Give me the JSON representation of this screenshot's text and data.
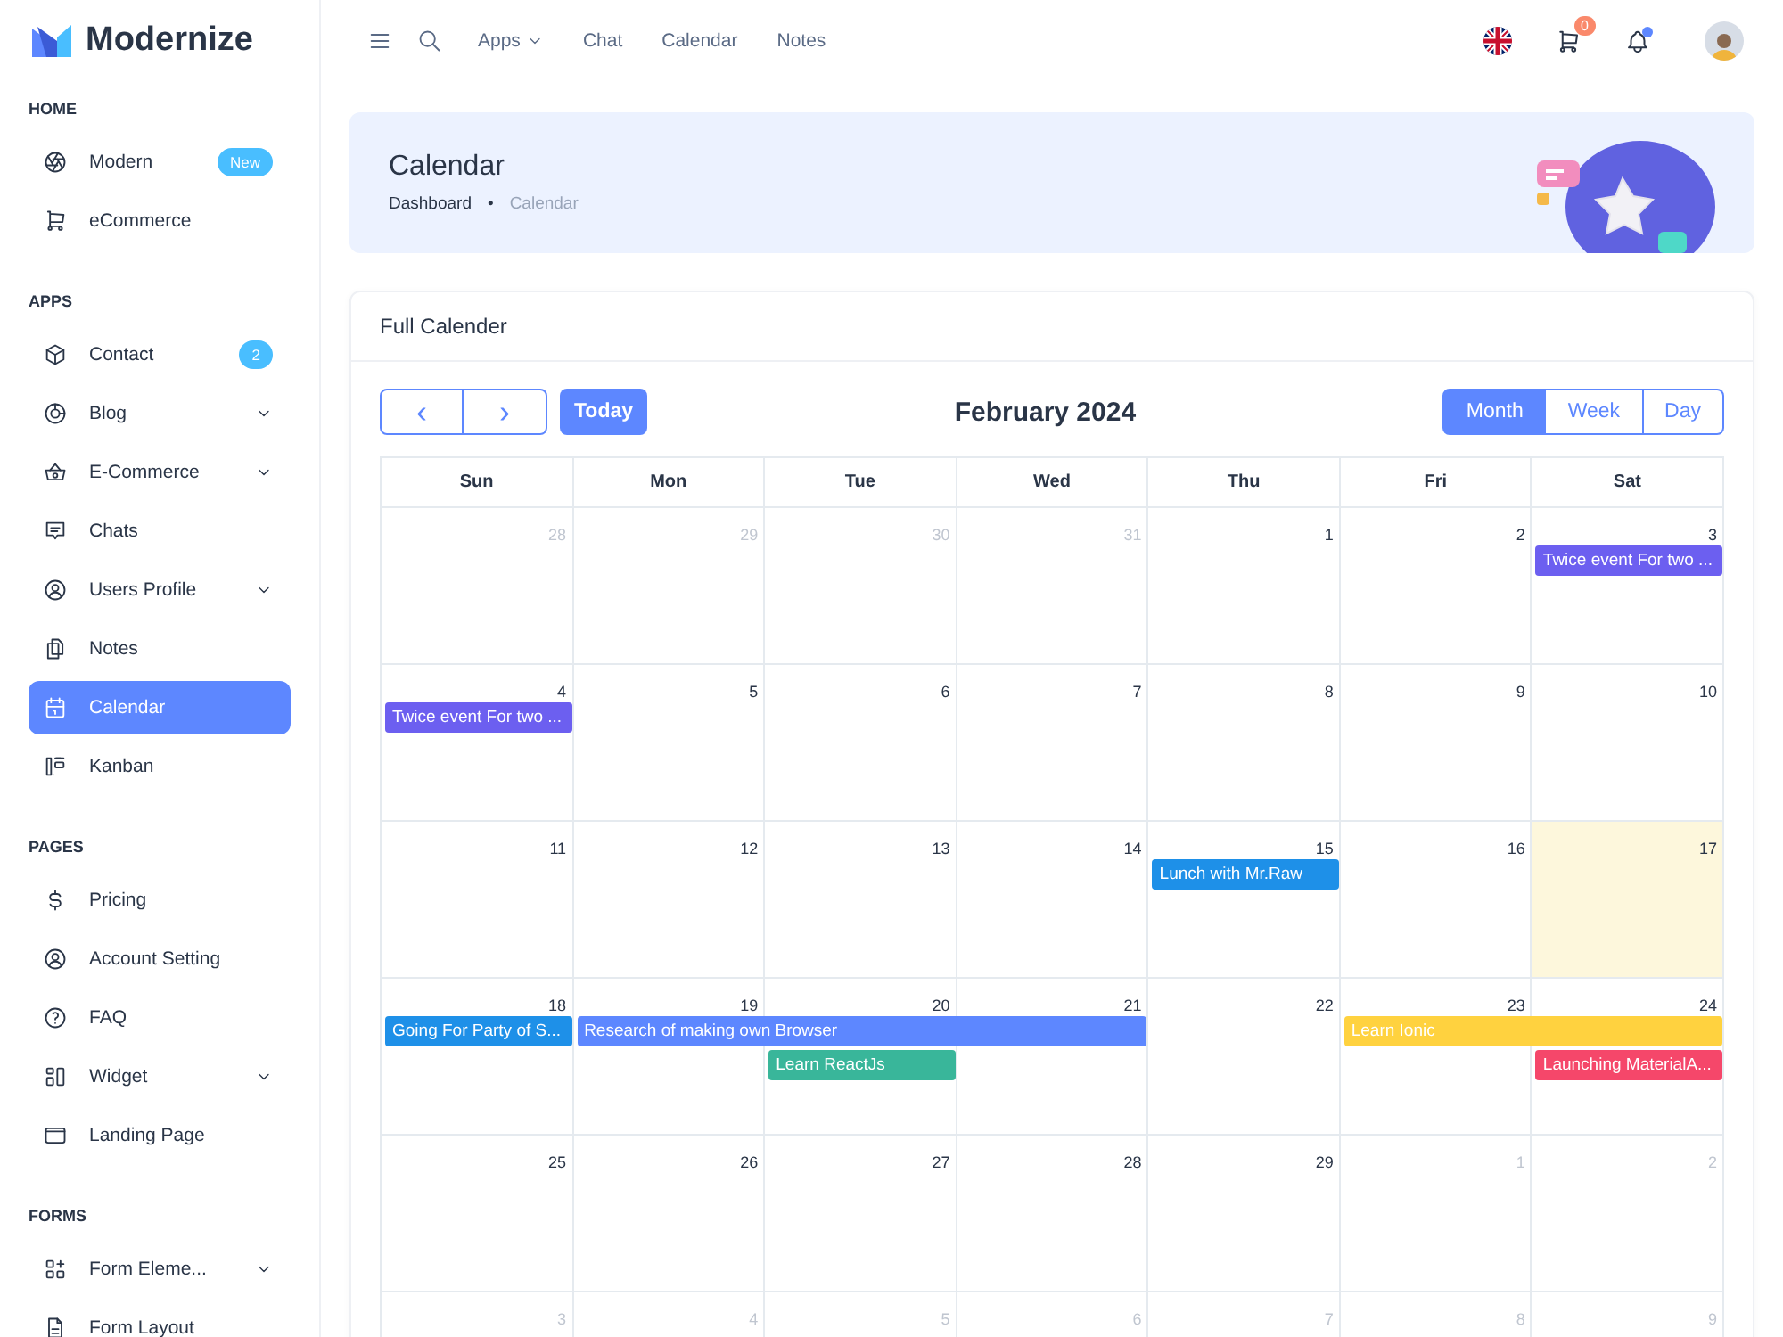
{
  "brand": {
    "name": "Modernize"
  },
  "sidebar": {
    "sections": [
      {
        "heading": "HOME",
        "items": [
          {
            "label": "Modern",
            "selected": false,
            "has_submenu": false,
            "badge": "New"
          },
          {
            "label": "eCommerce",
            "selected": false,
            "has_submenu": false
          }
        ]
      },
      {
        "heading": "APPS",
        "items": [
          {
            "label": "Contact",
            "selected": false,
            "has_submenu": false,
            "badge": "2"
          },
          {
            "label": "Blog",
            "selected": false,
            "has_submenu": true
          },
          {
            "label": "E-Commerce",
            "selected": false,
            "has_submenu": true
          },
          {
            "label": "Chats",
            "selected": false,
            "has_submenu": false
          },
          {
            "label": "Users Profile",
            "selected": false,
            "has_submenu": true
          },
          {
            "label": "Notes",
            "selected": false,
            "has_submenu": false
          },
          {
            "label": "Calendar",
            "selected": true,
            "has_submenu": false
          },
          {
            "label": "Kanban",
            "selected": false,
            "has_submenu": false
          }
        ]
      },
      {
        "heading": "PAGES",
        "items": [
          {
            "label": "Pricing",
            "selected": false,
            "has_submenu": false
          },
          {
            "label": "Account Setting",
            "selected": false,
            "has_submenu": false
          },
          {
            "label": "FAQ",
            "selected": false,
            "has_submenu": false
          },
          {
            "label": "Widget",
            "selected": false,
            "has_submenu": true
          },
          {
            "label": "Landing Page",
            "selected": false,
            "has_submenu": false
          }
        ]
      },
      {
        "heading": "FORMS",
        "items": [
          {
            "label": "Form Eleme...",
            "selected": false,
            "has_submenu": true
          },
          {
            "label": "Form Layout",
            "selected": false,
            "has_submenu": false
          }
        ]
      }
    ]
  },
  "topbar": {
    "links": [
      {
        "label": "Apps",
        "has_menu": true
      },
      {
        "label": "Chat",
        "has_menu": false
      },
      {
        "label": "Calendar",
        "has_menu": false
      },
      {
        "label": "Notes",
        "has_menu": false
      }
    ],
    "cart_count": "0",
    "notifications_unread": true
  },
  "banner": {
    "title": "Calendar",
    "breadcrumb": [
      {
        "label": "Dashboard",
        "current": false
      },
      {
        "label": "Calendar",
        "current": true
      }
    ],
    "separator": "•"
  },
  "calendar": {
    "card_title": "Full Calender",
    "prev": "‹",
    "next": "›",
    "today_button": "Today",
    "title": "February 2024",
    "views": [
      {
        "label": "Month",
        "selected": true
      },
      {
        "label": "Week",
        "selected": false
      },
      {
        "label": "Day",
        "selected": false
      }
    ],
    "weekdays": [
      "Sun",
      "Mon",
      "Tue",
      "Wed",
      "Thu",
      "Fri",
      "Sat"
    ],
    "weeks": [
      {
        "days": [
          {
            "label": "28",
            "muted": true,
            "today": false
          },
          {
            "label": "29",
            "muted": true,
            "today": false
          },
          {
            "label": "30",
            "muted": true,
            "today": false
          },
          {
            "label": "31",
            "muted": true,
            "today": false
          },
          {
            "label": "1",
            "muted": false,
            "today": false
          },
          {
            "label": "2",
            "muted": false,
            "today": false
          },
          {
            "label": "3",
            "muted": false,
            "today": false
          }
        ],
        "lanes": [
          [
            {
              "kind": "empty"
            },
            {
              "kind": "empty"
            },
            {
              "kind": "empty"
            },
            {
              "kind": "empty"
            },
            {
              "kind": "empty"
            },
            {
              "kind": "empty"
            },
            {
              "kind": "event",
              "title": "Twice event For two ...",
              "color": "#6c5ff0"
            }
          ]
        ]
      },
      {
        "days": [
          {
            "label": "4",
            "muted": false,
            "today": false
          },
          {
            "label": "5",
            "muted": false,
            "today": false
          },
          {
            "label": "6",
            "muted": false,
            "today": false
          },
          {
            "label": "7",
            "muted": false,
            "today": false
          },
          {
            "label": "8",
            "muted": false,
            "today": false
          },
          {
            "label": "9",
            "muted": false,
            "today": false
          },
          {
            "label": "10",
            "muted": false,
            "today": false
          }
        ],
        "lanes": [
          [
            {
              "kind": "event",
              "title": "Twice event For two ...",
              "color": "#6c5ff0"
            },
            {
              "kind": "empty"
            },
            {
              "kind": "empty"
            },
            {
              "kind": "empty"
            },
            {
              "kind": "empty"
            },
            {
              "kind": "empty"
            },
            {
              "kind": "empty"
            }
          ]
        ]
      },
      {
        "days": [
          {
            "label": "11",
            "muted": false,
            "today": false
          },
          {
            "label": "12",
            "muted": false,
            "today": false
          },
          {
            "label": "13",
            "muted": false,
            "today": false
          },
          {
            "label": "14",
            "muted": false,
            "today": false
          },
          {
            "label": "15",
            "muted": false,
            "today": false
          },
          {
            "label": "16",
            "muted": false,
            "today": false
          },
          {
            "label": "17",
            "muted": false,
            "today": true
          }
        ],
        "lanes": [
          [
            {
              "kind": "empty"
            },
            {
              "kind": "empty"
            },
            {
              "kind": "empty"
            },
            {
              "kind": "empty"
            },
            {
              "kind": "event",
              "title": "Lunch with Mr.Raw",
              "color": "#1e90e8"
            },
            {
              "kind": "empty"
            },
            {
              "kind": "empty"
            }
          ]
        ]
      },
      {
        "days": [
          {
            "label": "18",
            "muted": false,
            "today": false
          },
          {
            "label": "19",
            "muted": false,
            "today": false
          },
          {
            "label": "20",
            "muted": false,
            "today": false
          },
          {
            "label": "21",
            "muted": false,
            "today": false
          },
          {
            "label": "22",
            "muted": false,
            "today": false
          },
          {
            "label": "23",
            "muted": false,
            "today": false
          },
          {
            "label": "24",
            "muted": false,
            "today": false
          }
        ],
        "lanes": [
          [
            {
              "kind": "event",
              "title": "Going For Party of S...",
              "color": "#1e90e8"
            },
            {
              "kind": "event",
              "title": "Research of making own Browser",
              "color": "#5d87ff"
            },
            {
              "kind": "more"
            },
            {
              "kind": "more"
            },
            {
              "kind": "empty"
            },
            {
              "kind": "event",
              "title": "Learn Ionic",
              "color": "#ffd23f"
            },
            {
              "kind": "more"
            }
          ],
          [
            {
              "kind": "empty"
            },
            {
              "kind": "empty"
            },
            {
              "kind": "event",
              "title": "Learn ReactJs",
              "color": "#39b69a"
            },
            {
              "kind": "empty"
            },
            {
              "kind": "empty"
            },
            {
              "kind": "empty"
            },
            {
              "kind": "event",
              "title": "Launching MaterialA...",
              "color": "#f5476a"
            }
          ]
        ]
      },
      {
        "days": [
          {
            "label": "25",
            "muted": false,
            "today": false
          },
          {
            "label": "26",
            "muted": false,
            "today": false
          },
          {
            "label": "27",
            "muted": false,
            "today": false
          },
          {
            "label": "28",
            "muted": false,
            "today": false
          },
          {
            "label": "29",
            "muted": false,
            "today": false
          },
          {
            "label": "1",
            "muted": true,
            "today": false
          },
          {
            "label": "2",
            "muted": true,
            "today": false
          }
        ]
      },
      {
        "days": [
          {
            "label": "3",
            "muted": true,
            "today": false
          },
          {
            "label": "4",
            "muted": true,
            "today": false
          },
          {
            "label": "5",
            "muted": true,
            "today": false
          },
          {
            "label": "6",
            "muted": true,
            "today": false
          },
          {
            "label": "7",
            "muted": true,
            "today": false
          },
          {
            "label": "8",
            "muted": true,
            "today": false
          },
          {
            "label": "9",
            "muted": true,
            "today": false
          }
        ]
      }
    ]
  }
}
